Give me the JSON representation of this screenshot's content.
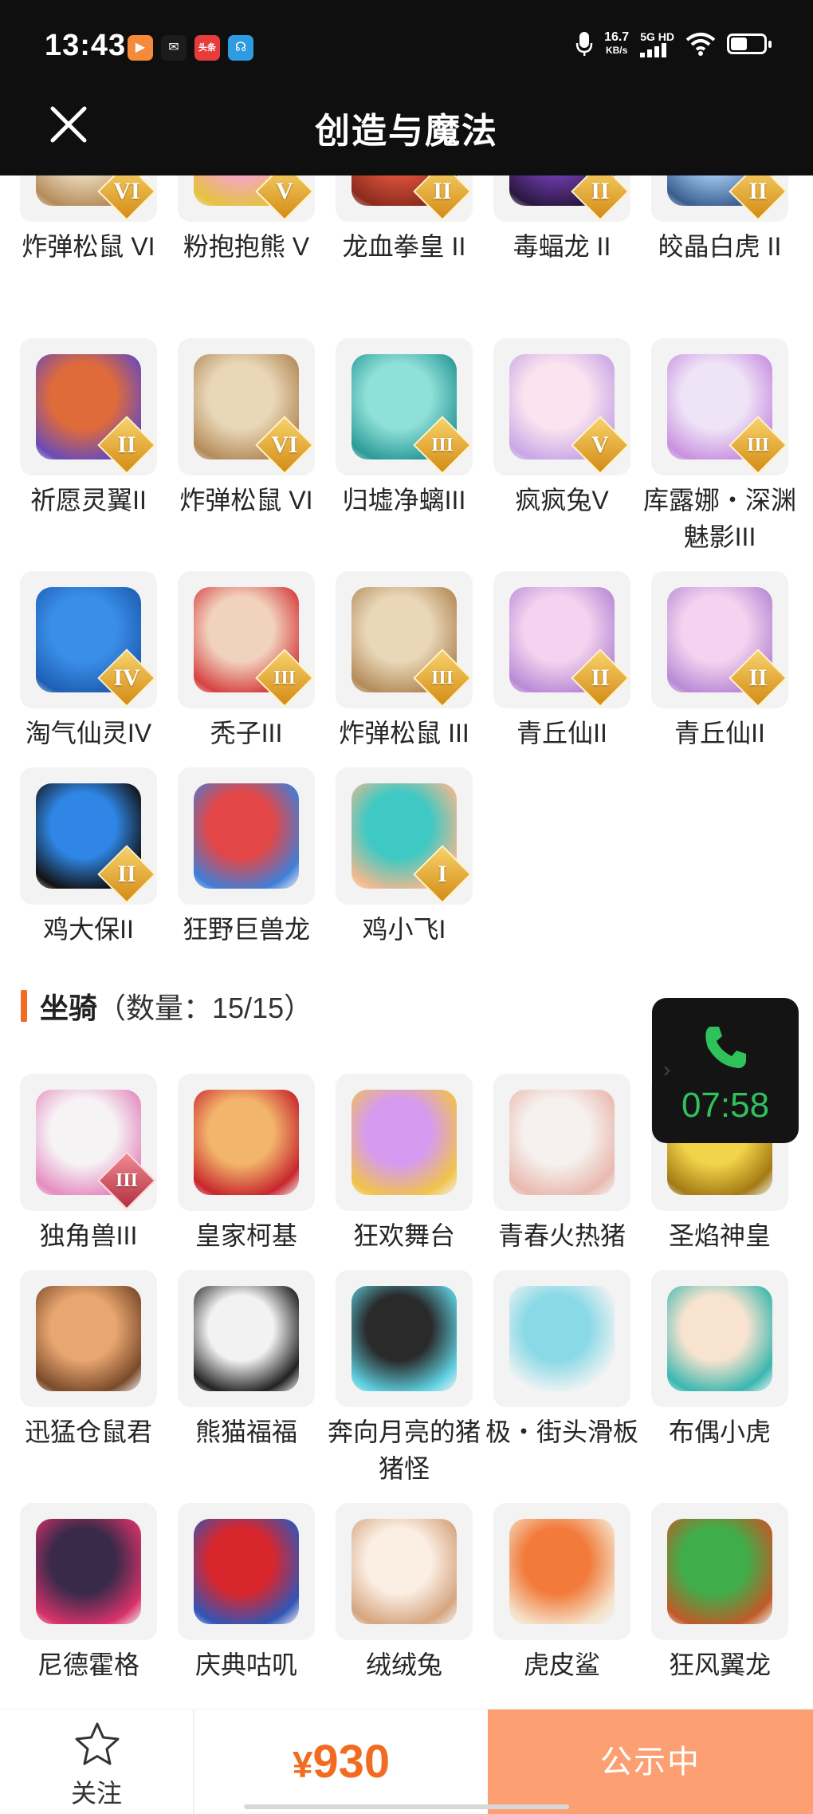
{
  "status_bar": {
    "time": "13:43",
    "app_icons": [
      {
        "name": "video-app-icon",
        "glyph": "▶",
        "color": "#f58a3b"
      },
      {
        "name": "wechat-icon",
        "glyph": "✉",
        "color": "#1c1c1c"
      },
      {
        "name": "toutiao-icon",
        "glyph": "头条",
        "color": "#e63c3c"
      },
      {
        "name": "signal-app-icon",
        "glyph": "☊",
        "color": "#2f9be0"
      }
    ],
    "speed_value": "16.7",
    "speed_unit": "KB/s",
    "network": "5G HD",
    "battery_level": 0.45
  },
  "header": {
    "title": "创造与魔法"
  },
  "pets_top": [
    {
      "label": "炸弹松鼠 VI",
      "badge": "VI",
      "colors": [
        "#e9d7b8",
        "#b48b5a"
      ]
    },
    {
      "label": "粉抱抱熊 V",
      "badge": "V",
      "colors": [
        "#f6a6c6",
        "#e5c23d"
      ]
    },
    {
      "label": "龙血拳皇 II",
      "badge": "II",
      "colors": [
        "#d9513a",
        "#8a2b1e"
      ]
    },
    {
      "label": "毒蝠龙 II",
      "badge": "II",
      "colors": [
        "#6b3aa8",
        "#2a173e"
      ]
    },
    {
      "label": "皎晶白虎 II",
      "badge": "II",
      "colors": [
        "#9bc2e9",
        "#3a5d8f"
      ]
    },
    {
      "label": "祈愿灵翼II",
      "badge": "II",
      "colors": [
        "#e06b3a",
        "#6a4bb8"
      ]
    },
    {
      "label": "炸弹松鼠 VI",
      "badge": "VI",
      "colors": [
        "#e9d7b8",
        "#b48b5a"
      ]
    },
    {
      "label": "归墟净螭III",
      "badge": "III",
      "colors": [
        "#8fe0d8",
        "#2b9a98"
      ]
    },
    {
      "label": "疯疯兔V",
      "badge": "V",
      "colors": [
        "#fbe3ef",
        "#c9a7e6"
      ]
    },
    {
      "label": "库露娜・深渊魅影III",
      "badge": "III",
      "colors": [
        "#efe4f7",
        "#c991e0"
      ]
    },
    {
      "label": "淘气仙灵IV",
      "badge": "IV",
      "colors": [
        "#3a8ee8",
        "#1e5fb3"
      ]
    },
    {
      "label": "秃子III",
      "badge": "III",
      "colors": [
        "#f1d2bd",
        "#d64141"
      ]
    },
    {
      "label": "炸弹松鼠 III",
      "badge": "III",
      "colors": [
        "#e9d7b8",
        "#b48b5a"
      ]
    },
    {
      "label": "青丘仙II",
      "badge": "II",
      "colors": [
        "#f3d3ef",
        "#b98ad6"
      ]
    },
    {
      "label": "青丘仙II",
      "badge": "II",
      "colors": [
        "#f3d3ef",
        "#b98ad6"
      ]
    },
    {
      "label": "鸡大保II",
      "badge": "II",
      "colors": [
        "#2f86e6",
        "#111111"
      ]
    },
    {
      "label": "狂野巨兽龙",
      "badge": "",
      "colors": [
        "#e24646",
        "#3f7fd9"
      ]
    },
    {
      "label": "鸡小飞I",
      "badge": "I",
      "colors": [
        "#3fc9c4",
        "#f0b98f"
      ]
    }
  ],
  "mounts_section": {
    "title": "坐骑",
    "count": "（数量：15/15）"
  },
  "mounts": [
    {
      "label": "独角兽III",
      "badge": "III",
      "badge_style": "gem",
      "colors": [
        "#f6f3f5",
        "#e48dc0"
      ]
    },
    {
      "label": "皇家柯基",
      "badge": "",
      "colors": [
        "#f2b56b",
        "#c8262d"
      ]
    },
    {
      "label": "狂欢舞台",
      "badge": "",
      "colors": [
        "#d69bf0",
        "#f1c34a"
      ]
    },
    {
      "label": "青春火热猪",
      "badge": "",
      "colors": [
        "#f6f1ee",
        "#e9b9b0"
      ]
    },
    {
      "label": "圣焰神皇",
      "badge": "",
      "colors": [
        "#f2d44a",
        "#a47a14"
      ]
    },
    {
      "label": "迅猛仓鼠君",
      "badge": "",
      "colors": [
        "#e8a670",
        "#7a4a2a"
      ]
    },
    {
      "label": "熊猫福福",
      "badge": "",
      "colors": [
        "#f2f2f2",
        "#222222"
      ]
    },
    {
      "label": "奔向月亮的猪猪怪",
      "badge": "",
      "colors": [
        "#2a2a2a",
        "#5ed0e0"
      ]
    },
    {
      "label": "极・街头滑板",
      "badge": "",
      "colors": [
        "#8ad9e6",
        "#f4f4f4"
      ]
    },
    {
      "label": "布偶小虎",
      "badge": "",
      "colors": [
        "#f7e3cf",
        "#3ab7b0"
      ]
    },
    {
      "label": "尼德霍格",
      "badge": "",
      "colors": [
        "#3a2a4a",
        "#d8326a"
      ]
    },
    {
      "label": "庆典咕叽",
      "badge": "",
      "colors": [
        "#d8262d",
        "#2f56b8"
      ]
    },
    {
      "label": "绒绒兔",
      "badge": "",
      "colors": [
        "#fbeee3",
        "#d5a57f"
      ]
    },
    {
      "label": "虎皮鲨",
      "badge": "",
      "colors": [
        "#f27a3a",
        "#f4e1c8"
      ]
    },
    {
      "label": "狂风翼龙",
      "badge": "",
      "colors": [
        "#3fae4a",
        "#c05a28"
      ]
    }
  ],
  "call_widget": {
    "timer": "07:58",
    "accent": "#2fc25b"
  },
  "bottom_bar": {
    "follow_label": "关注",
    "currency": "¥",
    "price": "930",
    "status_button": "公示中",
    "accent": "#f26b21",
    "button_color": "#fca074"
  }
}
